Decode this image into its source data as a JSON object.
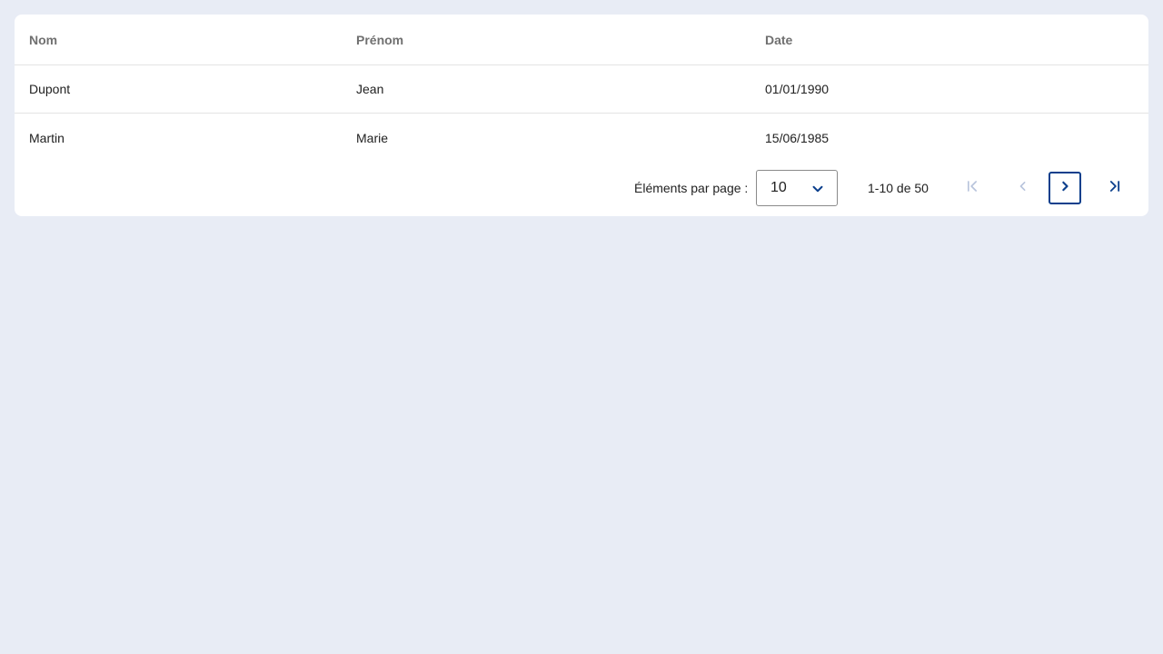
{
  "table": {
    "columns": [
      "Nom",
      "Prénom",
      "Date"
    ],
    "rows": [
      [
        "Dupont",
        "Jean",
        "01/01/1990"
      ],
      [
        "Martin",
        "Marie",
        "15/06/1985"
      ]
    ]
  },
  "paginator": {
    "items_per_page_label": "Éléments par page :",
    "page_size_value": "10",
    "range_label": "1-10 de 50",
    "buttons": {
      "first": "first-page-icon",
      "prev": "chevron-left-icon",
      "next": "chevron-right-icon",
      "last": "last-page-icon"
    }
  },
  "colors": {
    "background": "#e8ecf5",
    "accent": "#0b3f8c",
    "disabled": "#b8c4dc"
  }
}
